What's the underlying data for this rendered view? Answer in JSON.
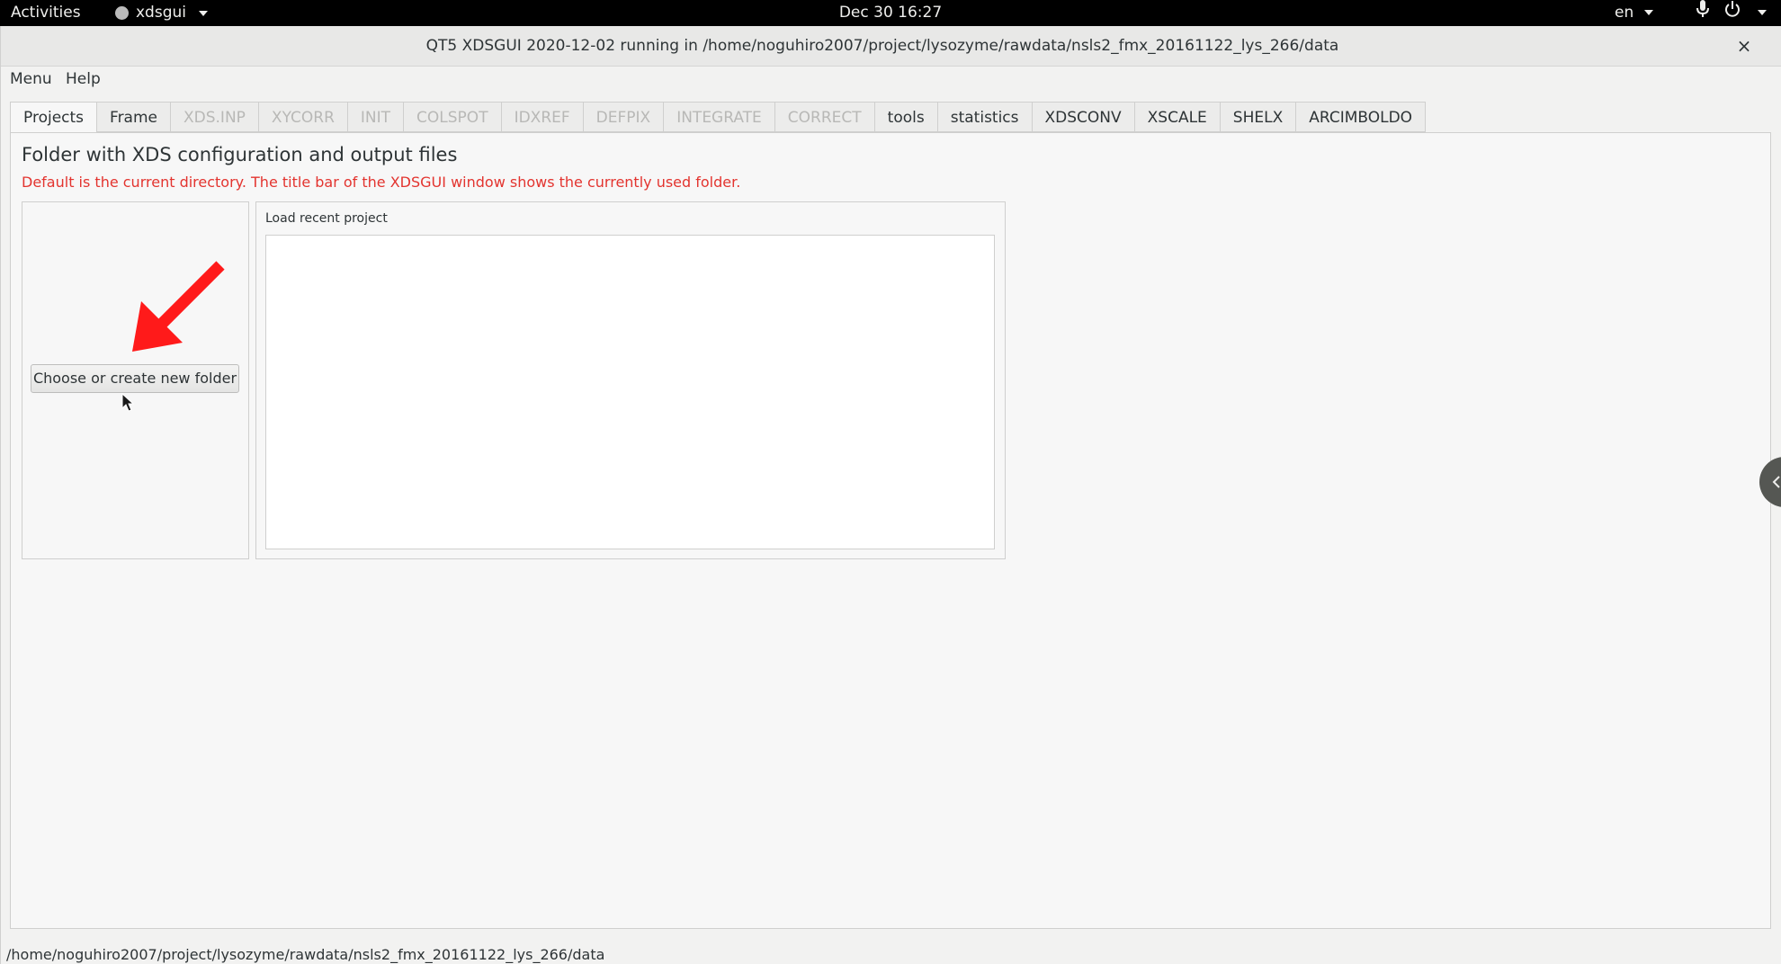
{
  "topbar": {
    "activities": "Activities",
    "app_name": "xdsgui",
    "clock": "Dec 30  16:27",
    "language": "en",
    "icons": [
      "app-dot-icon",
      "microphone-icon",
      "power-icon"
    ]
  },
  "window": {
    "title": "QT5 XDSGUI 2020-12-02 running in /home/noguhiro2007/project/lysozyme/rawdata/nsls2_fmx_20161122_lys_266/data",
    "close_label": "×"
  },
  "menubar": {
    "menu": "Menu",
    "help": "Help"
  },
  "tabs": [
    {
      "label": "Projects",
      "state": "active"
    },
    {
      "label": "Frame",
      "state": "enabled"
    },
    {
      "label": "XDS.INP",
      "state": "disabled"
    },
    {
      "label": "XYCORR",
      "state": "disabled"
    },
    {
      "label": "INIT",
      "state": "disabled"
    },
    {
      "label": "COLSPOT",
      "state": "disabled"
    },
    {
      "label": "IDXREF",
      "state": "disabled"
    },
    {
      "label": "DEFPIX",
      "state": "disabled"
    },
    {
      "label": "INTEGRATE",
      "state": "disabled"
    },
    {
      "label": "CORRECT",
      "state": "disabled"
    },
    {
      "label": "tools",
      "state": "enabled"
    },
    {
      "label": "statistics",
      "state": "enabled"
    },
    {
      "label": "XDSCONV",
      "state": "enabled"
    },
    {
      "label": "XSCALE",
      "state": "enabled"
    },
    {
      "label": "SHELX",
      "state": "enabled"
    },
    {
      "label": "ARCIMBOLDO",
      "state": "enabled"
    }
  ],
  "projects": {
    "heading": "Folder with XDS configuration and output files",
    "hint": "Default is the current directory. The title bar of the XDSGUI window shows the currently used folder.",
    "choose_button": "Choose or create new folder",
    "recent_label": "Load recent project",
    "recent_items": []
  },
  "status": {
    "path": "/home/noguhiro2007/project/lysozyme/rawdata/nsls2_fmx_20161122_lys_266/data"
  },
  "colors": {
    "hint_red": "#e3342f",
    "arrow_red": "#ff1a1a",
    "topbar_bg": "#000000"
  }
}
